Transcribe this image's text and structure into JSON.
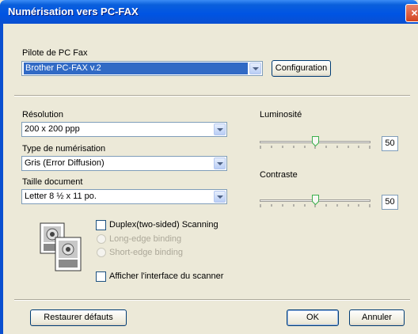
{
  "window": {
    "title": "Numérisation vers PC-FAX",
    "close_symbol": "×"
  },
  "fax_driver": {
    "label": "Pilote de PC Fax",
    "selected": "Brother PC-FAX v.2",
    "configuration_button": "Configuration"
  },
  "resolution": {
    "label": "Résolution",
    "value": "200 x 200 ppp"
  },
  "scan_type": {
    "label": "Type de numérisation",
    "value": "Gris (Error Diffusion)"
  },
  "document_size": {
    "label": "Taille document",
    "value": "Letter 8 ½ x 11 po."
  },
  "brightness": {
    "label": "Luminosité",
    "value": "50",
    "level_percent": 50
  },
  "contrast": {
    "label": "Contraste",
    "value": "50",
    "level_percent": 50
  },
  "duplex": {
    "checkbox_label": "Duplex(two-sided) Scanning",
    "checked": false,
    "long_edge_label": "Long-edge binding",
    "short_edge_label": "Short-edge binding"
  },
  "show_scanner_interface": {
    "label": "Afficher l'interface du scanner",
    "checked": false
  },
  "footer": {
    "restore_defaults": "Restaurer défauts",
    "ok": "OK",
    "cancel": "Annuler"
  }
}
